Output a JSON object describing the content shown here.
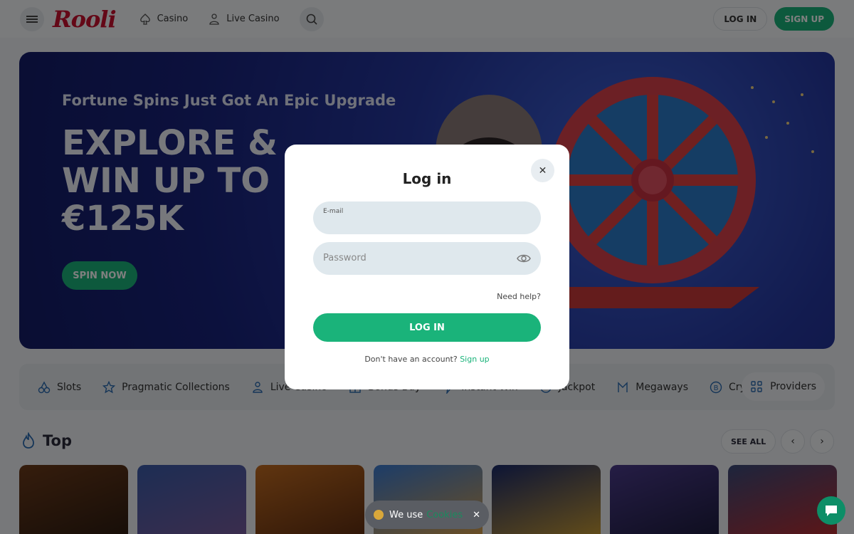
{
  "header": {
    "logo": "Rooli",
    "nav": [
      {
        "label": "Casino",
        "icon": "spade-icon"
      },
      {
        "label": "Live Casino",
        "icon": "dealer-icon"
      }
    ],
    "login_label": "LOG IN",
    "signup_label": "SIGN UP"
  },
  "hero": {
    "subtitle": "Fortune Spins Just Got An Epic Upgrade",
    "title": "EXPLORE & WIN UP TO €125K",
    "button": "SPIN NOW"
  },
  "categories": [
    {
      "label": "Slots",
      "icon": "cherries-icon"
    },
    {
      "label": "Pragmatic Collections",
      "icon": "star-icon"
    },
    {
      "label": "Live Casino",
      "icon": "dealer-icon"
    },
    {
      "label": "Bonus Buy",
      "icon": "bonus-icon"
    },
    {
      "label": "Instant Win",
      "icon": "instant-icon"
    },
    {
      "label": "Jackpot",
      "icon": "jackpot-icon"
    },
    {
      "label": "Megaways",
      "icon": "megaways-icon"
    },
    {
      "label": "Crypto Games",
      "icon": "bitcoin-icon"
    }
  ],
  "providers_label": "Providers",
  "top": {
    "title": "Top",
    "see_all": "SEE ALL",
    "tiles": [
      {
        "color1": "#6b3a1a",
        "color2": "#2a1a10"
      },
      {
        "color1": "#3a5aa8",
        "color2": "#7a5a9a"
      },
      {
        "color1": "#c06a20",
        "color2": "#5a2a10"
      },
      {
        "color1": "#3a7ad0",
        "color2": "#e0a040"
      },
      {
        "color1": "#1a2a6a",
        "color2": "#d0a030"
      },
      {
        "color1": "#4a3a8a",
        "color2": "#1a1a3a"
      },
      {
        "color1": "#3a4a7a",
        "color2": "#c02a2a"
      }
    ]
  },
  "modal": {
    "title": "Log in",
    "email_label": "E-mail",
    "password_placeholder": "Password",
    "need_help": "Need help?",
    "login_button": "LOG IN",
    "no_account": "Don't have an account?",
    "signup_link": "Sign up"
  },
  "cookie": {
    "text": "We use",
    "link": "Cookies"
  },
  "colors": {
    "accent": "#1ab37a",
    "brand": "#c8102e"
  }
}
